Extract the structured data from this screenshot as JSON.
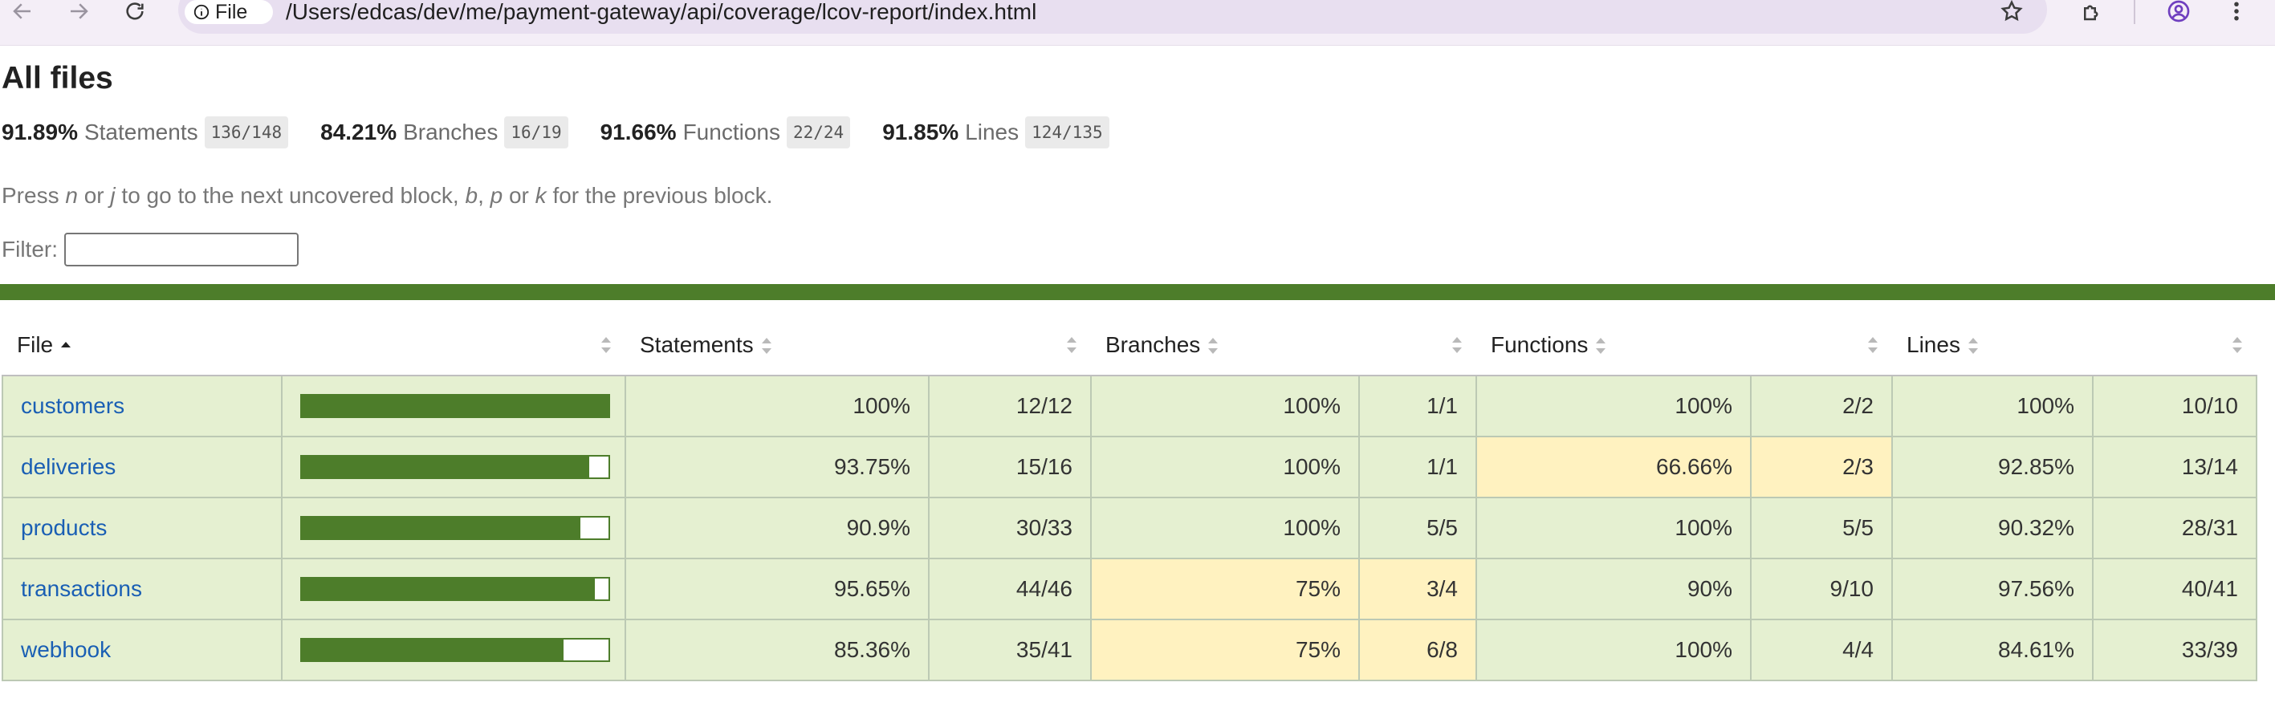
{
  "browser": {
    "chip_label": "File",
    "url": "/Users/edcas/dev/me/payment-gateway/api/coverage/lcov-report/index.html"
  },
  "page": {
    "title": "All files",
    "summary": [
      {
        "pct": "91.89%",
        "label": "Statements",
        "fraction": "136/148"
      },
      {
        "pct": "84.21%",
        "label": "Branches",
        "fraction": "16/19"
      },
      {
        "pct": "91.66%",
        "label": "Functions",
        "fraction": "22/24"
      },
      {
        "pct": "91.85%",
        "label": "Lines",
        "fraction": "124/135"
      }
    ],
    "hint": {
      "t1": "Press ",
      "k1": "n",
      "t2": " or ",
      "k2": "j",
      "t3": " to go to the next uncovered block, ",
      "k3": "b",
      "t4": ", ",
      "k4": "p",
      "t5": " or ",
      "k5": "k",
      "t6": " for the previous block."
    },
    "filter_label": "Filter:",
    "filter_value": ""
  },
  "table": {
    "headers": {
      "file": "File",
      "statements": "Statements",
      "branches": "Branches",
      "functions": "Functions",
      "lines": "Lines"
    },
    "rows": [
      {
        "file": "customers",
        "coverage": 1.0,
        "statements_pct": "100%",
        "statements": "12/12",
        "branches_pct": "100%",
        "branches": "1/1",
        "functions_pct": "100%",
        "functions": "2/2",
        "lines_pct": "100%",
        "lines": "10/10"
      },
      {
        "file": "deliveries",
        "coverage": 0.9375,
        "statements_pct": "93.75%",
        "statements": "15/16",
        "branches_pct": "100%",
        "branches": "1/1",
        "functions_pct": "66.66%",
        "functions": "2/3",
        "lines_pct": "92.85%",
        "lines": "13/14"
      },
      {
        "file": "products",
        "coverage": 0.909,
        "statements_pct": "90.9%",
        "statements": "30/33",
        "branches_pct": "100%",
        "branches": "5/5",
        "functions_pct": "100%",
        "functions": "5/5",
        "lines_pct": "90.32%",
        "lines": "28/31"
      },
      {
        "file": "transactions",
        "coverage": 0.9565,
        "statements_pct": "95.65%",
        "statements": "44/46",
        "branches_pct": "75%",
        "branches": "3/4",
        "functions_pct": "90%",
        "functions": "9/10",
        "lines_pct": "97.56%",
        "lines": "40/41"
      },
      {
        "file": "webhook",
        "coverage": 0.8536,
        "statements_pct": "85.36%",
        "statements": "35/41",
        "branches_pct": "75%",
        "branches": "6/8",
        "functions_pct": "100%",
        "functions": "4/4",
        "lines_pct": "84.61%",
        "lines": "33/39"
      }
    ]
  },
  "colors": {
    "high": "#e5f0d1",
    "medium": "#fff2c0",
    "bar_fill": "#4d7d2a",
    "link": "#1a5fb4"
  }
}
